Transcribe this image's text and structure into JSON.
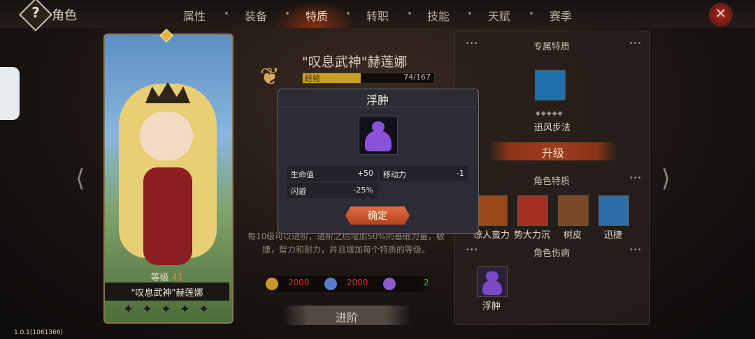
{
  "header": {
    "title": "角色",
    "help_icon": "?",
    "tabs": [
      "属性",
      "装备",
      "特质",
      "转职",
      "技能",
      "天赋",
      "赛季"
    ],
    "active_tab": "特质",
    "close_icon": "✕",
    "accent": "#d23c14"
  },
  "card": {
    "level_label": "等级",
    "level": "41",
    "name": "\"叹息武神\"赫莲娜",
    "stars": [
      "✦",
      "✦",
      "✦",
      "✦",
      "✦"
    ]
  },
  "nav": {
    "prev": "⟨",
    "next": "⟩"
  },
  "hero": {
    "name": "\"叹息武神\"赫莲娜",
    "exp_label": "经验",
    "exp_value": "74/167",
    "exp_fraction": 0.443,
    "emblem": "❦",
    "description": "每10级可以进阶，进阶之后增加50%的基础力量，敏捷，智力和耐力，并且增加每个特质的等级。",
    "costs": [
      {
        "icon_name": "gold-coin-icon",
        "value": "2000",
        "color": "#c9962a"
      },
      {
        "icon_name": "blue-star-icon",
        "value": "2000",
        "color": "#5a7ec9"
      },
      {
        "icon_name": "purple-star-icon",
        "value": "2",
        "color": "#8d5ac9"
      }
    ],
    "advance_label": "进阶"
  },
  "right": {
    "exclusive": {
      "title": "专属特质",
      "trait_name": "迅风步法",
      "icon_name": "sock-icon",
      "pips": "◆◆◆◆◆",
      "upgrade_label": "升级"
    },
    "traits": {
      "title": "角色特质",
      "items": [
        {
          "label": "惊人蛮力",
          "icon": "bull-icon",
          "color": "#9a4a1a"
        },
        {
          "label": "势大力沉",
          "icon": "hammer-icon",
          "color": "#a33021"
        },
        {
          "label": "树皮",
          "icon": "bark-icon",
          "color": "#7a4a26"
        },
        {
          "label": "迅捷",
          "icon": "arrow-up-icon",
          "color": "#2f6fa8"
        }
      ]
    },
    "ailments": {
      "title": "角色伤病",
      "items": [
        {
          "label": "浮肿",
          "icon": "bloated-icon",
          "color": "#6a3aa8"
        }
      ]
    }
  },
  "modal": {
    "title": "浮肿",
    "icon_name": "bloated-icon",
    "stats": [
      {
        "key": "生命值",
        "value": "+50"
      },
      {
        "key": "移动力",
        "value": "-1"
      },
      {
        "key": "闪避",
        "value": "-25%"
      }
    ],
    "confirm_label": "确定"
  },
  "version": "1.0.1(1061366)"
}
